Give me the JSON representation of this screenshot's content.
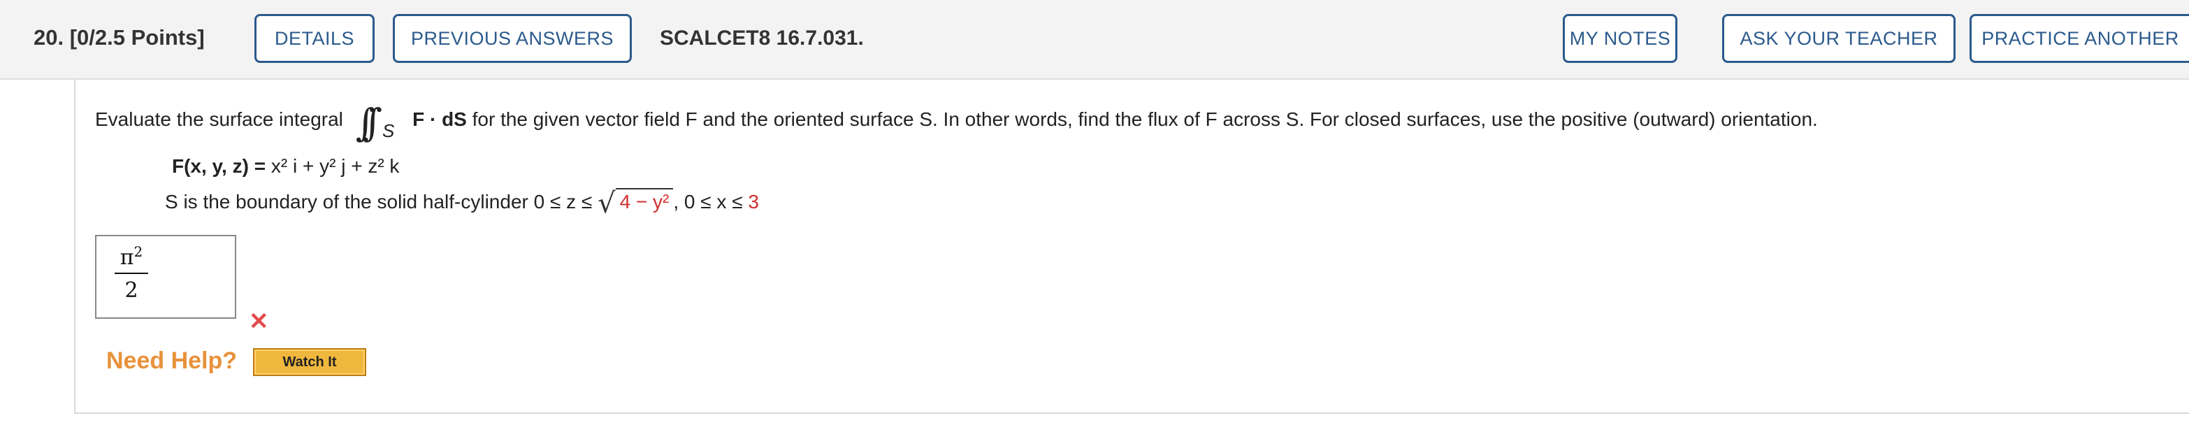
{
  "header": {
    "question_number": "20.",
    "points": "[0/2.5 Points]",
    "details_label": "DETAILS",
    "previous_answers_label": "PREVIOUS ANSWERS",
    "reference": "SCALCET8 16.7.031.",
    "my_notes_label": "MY NOTES",
    "ask_teacher_label": "ASK YOUR TEACHER",
    "practice_another_label": "PRACTICE ANOTHER"
  },
  "question": {
    "prompt_start": "Evaluate the surface integral",
    "integral_symbol": "∫∫",
    "integral_subscript": "S",
    "integrand": "F · dS",
    "prompt_end": "for the given vector field F and the oriented surface S. In other words, find the flux of F across S. For closed surfaces, use the positive (outward) orientation.",
    "field_lhs": "F(x, y, z) = ",
    "field_rhs": "x² i + y² j + z² k",
    "surface_start": "S is the boundary of the solid half-cylinder  0 ≤ z ≤ ",
    "sqrt_expr": "4 − y²",
    "surface_mid": ", 0 ≤ x ≤ ",
    "x_upper": "3"
  },
  "answer": {
    "numerator": "π",
    "exponent": "2",
    "denominator": "2",
    "status": "incorrect"
  },
  "help": {
    "need_help_label": "Need Help?",
    "watch_it_label": "Watch It"
  },
  "colors": {
    "button_border": "#2b5a8c",
    "highlight_red": "#d32f2f",
    "incorrect_x": "#e24a4a",
    "need_help": "#e8923a",
    "watch_button": "#f0b73d"
  }
}
